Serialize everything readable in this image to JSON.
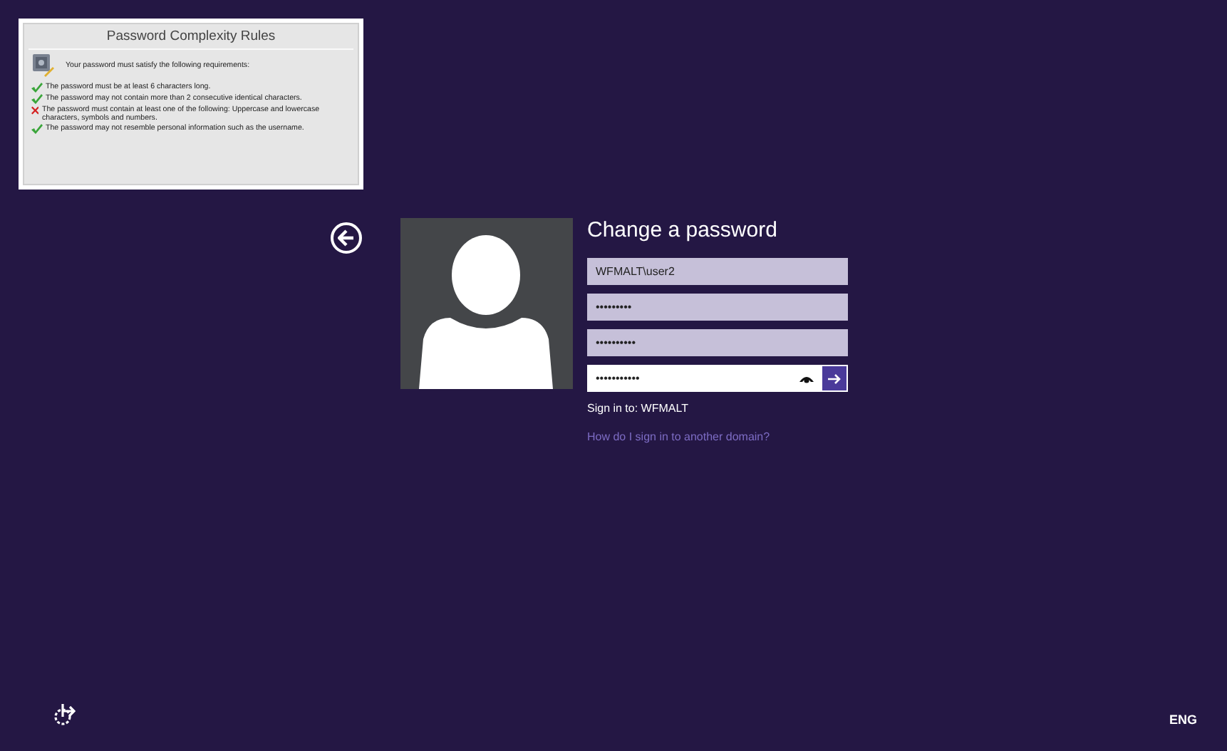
{
  "rules_panel": {
    "title": "Password Complexity Rules",
    "intro": "Your password must satisfy the following requirements:",
    "rules": [
      {
        "text": "The password must be at least 6 characters long.",
        "passed": true
      },
      {
        "text": "The password may not contain more than 2 consecutive identical characters.",
        "passed": true
      },
      {
        "text": "The password must contain at least one of the following: Uppercase and lowercase characters, symbols and numbers.",
        "passed": false
      },
      {
        "text": "The password may not resemble personal information such as the username.",
        "passed": true
      }
    ]
  },
  "heading": "Change a password",
  "fields": [
    {
      "value": "WFMALT\\user2",
      "focused": false
    },
    {
      "value": "•••••••••",
      "focused": false
    },
    {
      "value": "••••••••••",
      "focused": false
    },
    {
      "value": "•••••••••••",
      "focused": true
    }
  ],
  "sign_in_to": "Sign in to: WFMALT",
  "domain_link": "How do I sign in to another domain?",
  "language": "ENG"
}
